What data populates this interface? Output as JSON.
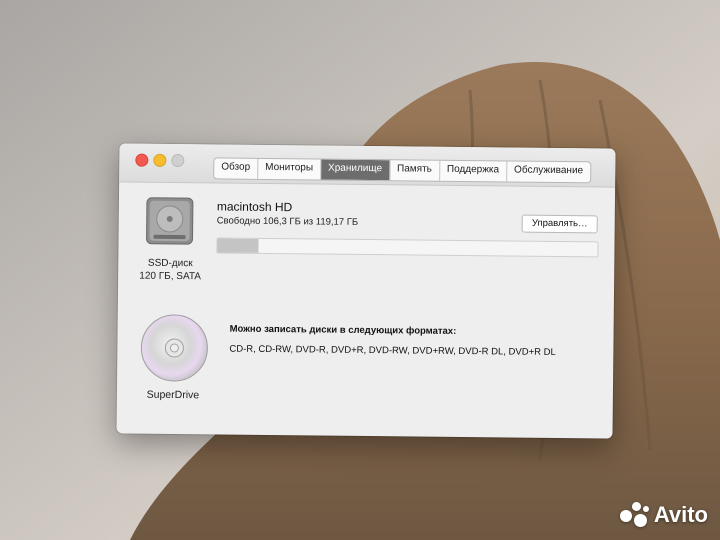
{
  "window": {
    "tabs": [
      {
        "label": "Обзор",
        "active": false
      },
      {
        "label": "Мониторы",
        "active": false
      },
      {
        "label": "Хранилище",
        "active": true
      },
      {
        "label": "Память",
        "active": false
      },
      {
        "label": "Поддержка",
        "active": false
      },
      {
        "label": "Обслуживание",
        "active": false
      }
    ]
  },
  "storage": {
    "disk": {
      "icon": "hard-drive-icon",
      "type_label": "SSD-диск",
      "spec_label": "120 ГБ, SATA"
    },
    "volume": {
      "name": "macintosh HD",
      "free_text": "Свободно 106,3 ГБ из 119,17 ГБ",
      "used_fraction": 0.108,
      "manage_label": "Управлять…"
    },
    "optical": {
      "icon": "cd-icon",
      "name": "SuperDrive",
      "formats_heading": "Можно записать диски в следующих форматах:",
      "formats_list": "CD-R, CD-RW, DVD-R, DVD+R, DVD-RW, DVD+RW, DVD-R DL, DVD+R DL"
    }
  },
  "watermark": {
    "text": "Avito"
  },
  "colors": {
    "active_tab": "#6d6d6d",
    "close": "#f25a50",
    "minimize": "#f7bd2f"
  }
}
